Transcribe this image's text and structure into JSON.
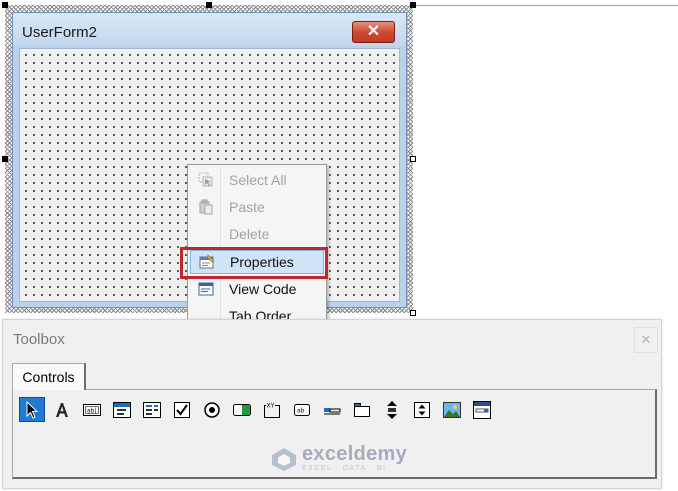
{
  "userform": {
    "title": "UserForm2",
    "close_glyph": "✕"
  },
  "context_menu": {
    "items": [
      {
        "label": "Select All",
        "enabled": false,
        "icon": "select-all-icon"
      },
      {
        "label": "Paste",
        "enabled": false,
        "icon": "paste-icon"
      },
      {
        "label": "Delete",
        "enabled": false,
        "icon": null
      },
      {
        "label": "Properties",
        "enabled": true,
        "highlighted": true,
        "icon": "properties-icon"
      },
      {
        "label": "View Code",
        "enabled": true,
        "icon": "view-code-icon"
      },
      {
        "label": "Tab Order",
        "enabled": true,
        "icon": null
      }
    ]
  },
  "toolbox": {
    "title": "Toolbox",
    "close_glyph": "✕",
    "tab_label": "Controls",
    "tools": [
      "select-objects-icon",
      "label-icon",
      "textbox-icon",
      "combobox-icon",
      "listbox-icon",
      "checkbox-icon",
      "optionbutton-icon",
      "togglebutton-icon",
      "frame-icon",
      "commandbutton-icon",
      "tabstrip-icon",
      "multipage-icon",
      "scrollbar-icon",
      "spinbutton-icon",
      "image-icon",
      "refedit-icon"
    ]
  },
  "watermark": {
    "name": "exceldemy",
    "tagline": "EXCEL · DATA · BI"
  },
  "colors": {
    "highlight_border": "#c0272d",
    "menu_highlight": "#cfe4f7",
    "selected_tool": "#1e7bd0",
    "form_border": "#b9d1ea"
  }
}
